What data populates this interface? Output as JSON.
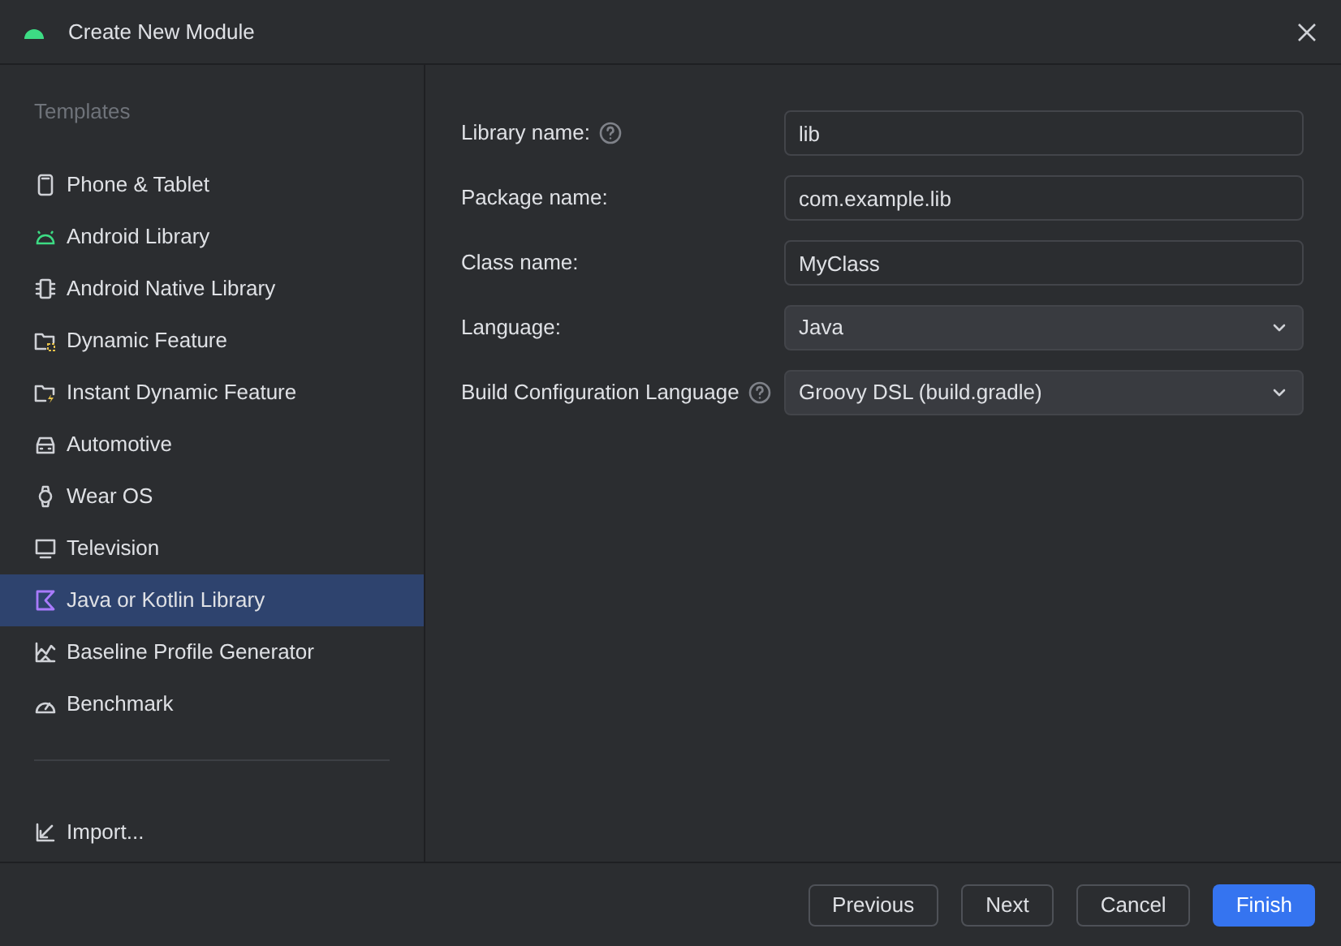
{
  "window": {
    "title": "Create New Module"
  },
  "sidebar": {
    "heading": "Templates",
    "items": [
      {
        "label": "Phone & Tablet",
        "selected": false
      },
      {
        "label": "Android Library",
        "selected": false
      },
      {
        "label": "Android Native Library",
        "selected": false
      },
      {
        "label": "Dynamic Feature",
        "selected": false
      },
      {
        "label": "Instant Dynamic Feature",
        "selected": false
      },
      {
        "label": "Automotive",
        "selected": false
      },
      {
        "label": "Wear OS",
        "selected": false
      },
      {
        "label": "Television",
        "selected": false
      },
      {
        "label": "Java or Kotlin Library",
        "selected": true
      },
      {
        "label": "Baseline Profile Generator",
        "selected": false
      },
      {
        "label": "Benchmark",
        "selected": false
      }
    ],
    "import": "Import..."
  },
  "form": [
    {
      "label": "Library name:",
      "help": true,
      "kind": "text",
      "value": "lib"
    },
    {
      "label": "Package name:",
      "help": false,
      "kind": "text",
      "value": "com.example.lib"
    },
    {
      "label": "Class name:",
      "help": false,
      "kind": "text",
      "value": "MyClass"
    },
    {
      "label": "Language:",
      "help": false,
      "kind": "select",
      "value": "Java"
    },
    {
      "label": "Build Configuration Language",
      "help": true,
      "kind": "select",
      "value": "Groovy DSL (build.gradle)"
    }
  ],
  "buttons": [
    {
      "label": "Previous",
      "primary": false
    },
    {
      "label": "Next",
      "primary": false
    },
    {
      "label": "Cancel",
      "primary": false
    },
    {
      "label": "Finish",
      "primary": true
    }
  ]
}
